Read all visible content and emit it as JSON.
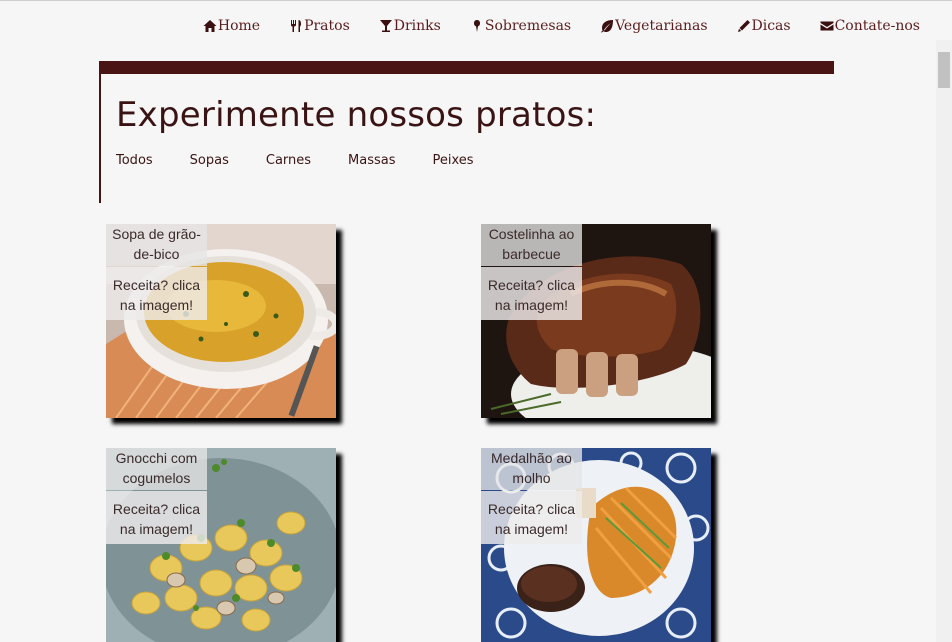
{
  "nav": {
    "items": [
      {
        "label": "Home",
        "icon": "home-icon"
      },
      {
        "label": "Pratos",
        "icon": "fork-knife-icon"
      },
      {
        "label": "Drinks",
        "icon": "cocktail-glass-icon"
      },
      {
        "label": "Sobremesas",
        "icon": "ice-cream-icon"
      },
      {
        "label": "Vegetarianas",
        "icon": "leaf-icon"
      },
      {
        "label": "Dicas",
        "icon": "pencil-icon"
      },
      {
        "label": "Contate-nos",
        "icon": "envelope-icon"
      }
    ]
  },
  "main": {
    "title": "Experimente nossos pratos:",
    "filters": [
      "Todos",
      "Sopas",
      "Carnes",
      "Massas",
      "Peixes"
    ]
  },
  "cards": [
    {
      "title": "Sopa de grão-de-bico",
      "hint": "Receita? clica na imagem!",
      "photo": "chickpea-soup-photo"
    },
    {
      "title": "Costelinha ao barbecue",
      "hint": "Receita? clica na imagem!",
      "photo": "bbq-ribs-photo"
    },
    {
      "title": "Gnocchi com cogumelos",
      "hint": "Receita? clica na imagem!",
      "photo": "gnocchi-mushrooms-photo"
    },
    {
      "title": "Medalhão ao molho",
      "hint": "Receita? clica na imagem!",
      "photo": "medallion-sauce-photo"
    }
  ],
  "colors": {
    "accent": "#4b1414",
    "text": "#3a1414",
    "background": "#f7f6f6"
  }
}
